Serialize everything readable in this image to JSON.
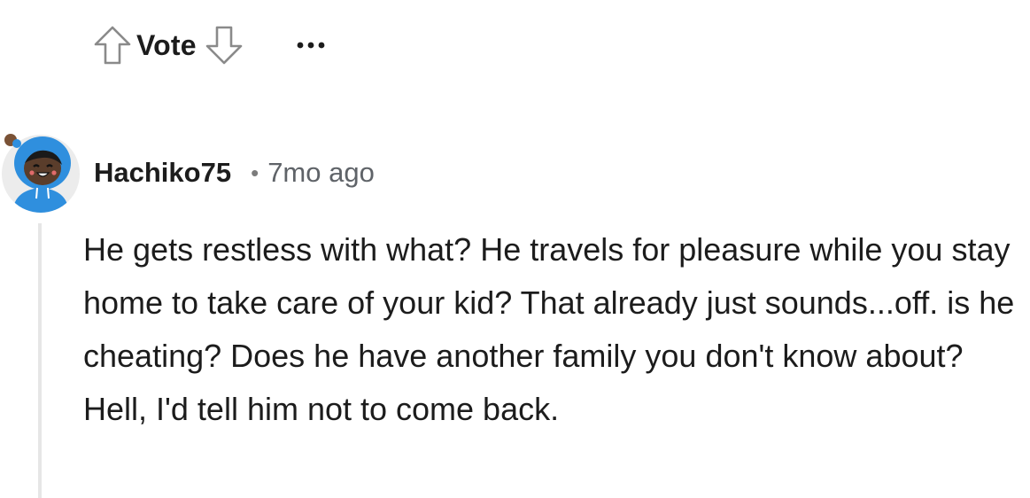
{
  "vote_bar": {
    "upvote_icon": "arrow-up-outline-icon",
    "label": "Vote",
    "downvote_icon": "arrow-down-outline-icon",
    "more_icon": "ellipsis-horizontal-icon"
  },
  "comment": {
    "author": "Hachiko75",
    "separator": "•",
    "time": "7mo ago",
    "avatar_icon": "snoo-avatar-blue-hoodie",
    "body": "He gets restless with what? He travels for pleasure while you stay home to take care of your kid? That already just sounds...off. is he cheating? Does he have another family you don't know about? Hell, I'd tell him not to come back."
  },
  "colors": {
    "text": "#1c1c1c",
    "meta": "#5f6368",
    "icon_stroke": "#8a8a8a",
    "thread_line": "#e6e6e6",
    "avatar_blue": "#2f8fde"
  }
}
